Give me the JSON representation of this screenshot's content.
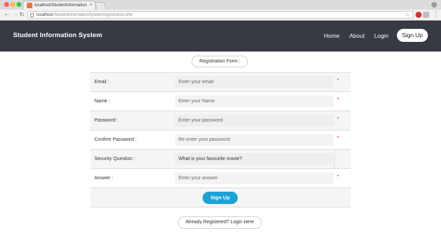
{
  "browser": {
    "tab_title": "localhost/StudentInformationS",
    "tab_close": "×",
    "url_host": "localhost",
    "url_path": "/StudentInformationSystem/registration.php",
    "star": "☆",
    "menu": "⋮"
  },
  "navbar": {
    "brand": "Student Information System",
    "links": [
      "Home",
      "About",
      "Login"
    ],
    "signup_label": "Sign Up"
  },
  "form": {
    "title": "Registration Form :",
    "required_mark": "*",
    "rows": [
      {
        "label": "Email :",
        "placeholder": "Enter your email",
        "required": true
      },
      {
        "label": "Name :",
        "placeholder": "Enter your Name",
        "required": true
      },
      {
        "label": "Password :",
        "placeholder": "Enter your password",
        "required": true
      },
      {
        "label": "Confirm Password :",
        "placeholder": "Re-enter your password",
        "required": true
      },
      {
        "label": "Security Question :",
        "selected": "What is your favourite movie?"
      },
      {
        "label": "Answer :",
        "placeholder": "Enter your answer",
        "required": true
      }
    ],
    "submit_label": "Sign Up",
    "login_link": "Already Registered? Login Here"
  }
}
